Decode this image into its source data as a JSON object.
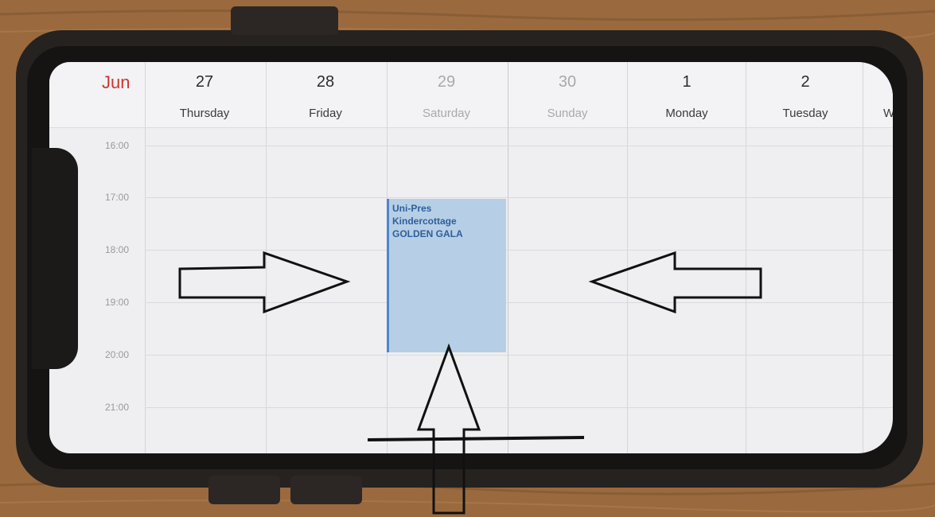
{
  "calendar": {
    "month": "Jun",
    "days": [
      {
        "num": "27",
        "name": "Thursday",
        "weekend": false
      },
      {
        "num": "28",
        "name": "Friday",
        "weekend": false
      },
      {
        "num": "29",
        "name": "Saturday",
        "weekend": true
      },
      {
        "num": "30",
        "name": "Sunday",
        "weekend": true
      },
      {
        "num": "1",
        "name": "Monday",
        "weekend": false
      },
      {
        "num": "2",
        "name": "Tuesday",
        "weekend": false
      }
    ],
    "next_day_partial": "W",
    "hours": [
      "16:00",
      "17:00",
      "18:00",
      "19:00",
      "20:00",
      "21:00"
    ],
    "event": {
      "lines": [
        "Uni-Pres",
        "Kindercottage",
        "GOLDEN GALA"
      ]
    }
  },
  "colors": {
    "month_accent": "#d0342c",
    "event_fill": "#b6cfe6",
    "event_bar": "#4f86c9",
    "event_text": "#2e5f9a",
    "wood": "#9a6a3e"
  },
  "annotations": [
    "right-arrow",
    "left-arrow",
    "up-arrow",
    "underline"
  ]
}
